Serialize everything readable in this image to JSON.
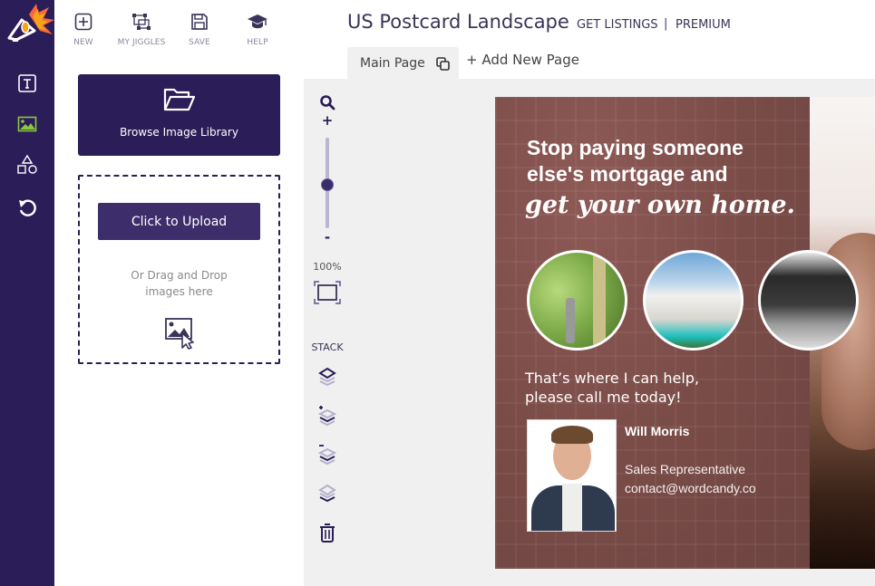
{
  "toolbar": {
    "new_label": "NEW",
    "my_jiggles_label": "MY JIGGLES",
    "save_label": "SAVE",
    "help_label": "HELP"
  },
  "rail": {
    "items": [
      {
        "icon": "text-icon",
        "label": "Text"
      },
      {
        "icon": "image-icon",
        "label": "Images",
        "active": true
      },
      {
        "icon": "shapes-icon",
        "label": "Shapes"
      },
      {
        "icon": "undo-icon",
        "label": "Undo"
      }
    ],
    "active_color": "#8cc63f"
  },
  "panel": {
    "browse_label": "Browse Image Library",
    "upload_label": "Click to Upload",
    "drop_text_line1": "Or Drag and Drop",
    "drop_text_line2": "images here"
  },
  "header": {
    "title": "US Postcard Landscape",
    "get_listings": "GET LISTINGS",
    "separator": "|",
    "premium": "PREMIUM"
  },
  "pages": {
    "tabs": [
      {
        "label": "Main Page",
        "active": true
      }
    ],
    "add_label": "+ Add New Page"
  },
  "zoom": {
    "plus": "+",
    "minus": "-",
    "value": "100%",
    "level_percent": 100
  },
  "stack": {
    "label": "STACK"
  },
  "postcard": {
    "headline_line1": "Stop paying someone",
    "headline_line2": "else's mortgage and",
    "script_line": "get your own home.",
    "tagline_line1": "That’s where I can help,",
    "tagline_line2": "please call me today!",
    "agent_name": "Will Morris",
    "agent_role": "Sales Representative",
    "agent_email": "contact@wordcandy.co"
  },
  "colors": {
    "brand": "#2b1d58",
    "button": "#3d2e6b",
    "workspace_bg": "#f0f0f0",
    "postcard_overlay": "#7a4c48"
  }
}
